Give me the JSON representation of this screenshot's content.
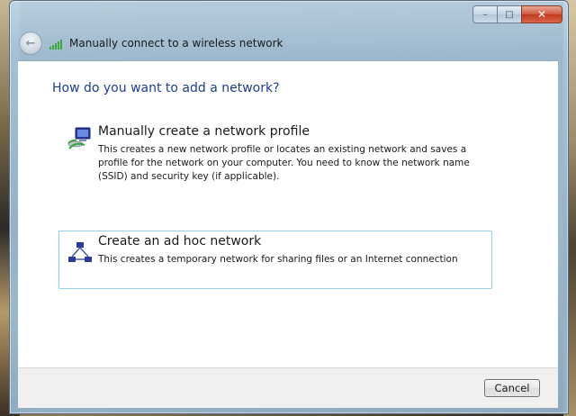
{
  "window": {
    "title": "Manually connect to a wireless network",
    "caption_buttons": {
      "minimize": "–",
      "maximize": "□",
      "close": "✕"
    },
    "back_arrow": "←"
  },
  "main": {
    "question": "How do you want to add a network?",
    "options": [
      {
        "title": "Manually create a network profile",
        "description": "This creates a new network profile or locates an existing network and saves a profile for the network on your computer. You need to know the network name (SSID) and security key (if applicable).",
        "icon": "network-profile-icon"
      },
      {
        "title": "Create an ad hoc network",
        "description": "This creates a temporary network for sharing files or an Internet connection",
        "icon": "ad-hoc-network-icon"
      }
    ]
  },
  "footer": {
    "cancel_label": "Cancel"
  },
  "colors": {
    "heading": "#1e3d8a",
    "focus_border": "#8fd3ea",
    "signal_green": "#3aa83a"
  }
}
